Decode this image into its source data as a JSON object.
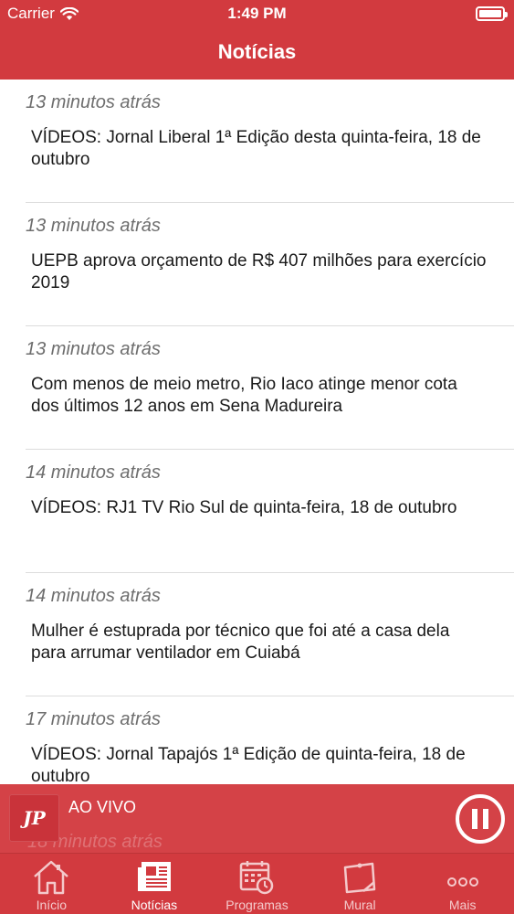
{
  "status_bar": {
    "carrier": "Carrier",
    "time": "1:49 PM"
  },
  "header": {
    "title": "Notícias"
  },
  "news": [
    {
      "time_ago": "13 minutos atrás",
      "title": "VÍDEOS: Jornal Liberal 1ª Edição desta quinta-feira, 18 de outubro"
    },
    {
      "time_ago": "13 minutos atrás",
      "title": "UEPB aprova orçamento de R$ 407 milhões para exercício 2019"
    },
    {
      "time_ago": "13 minutos atrás",
      "title": "Com menos de meio metro, Rio Iaco atinge menor cota dos últimos 12 anos em Sena Madureira"
    },
    {
      "time_ago": "14 minutos atrás",
      "title": "VÍDEOS: RJ1 TV Rio Sul de quinta-feira, 18 de outubro"
    },
    {
      "time_ago": "14 minutos atrás",
      "title": "Mulher é estuprada por técnico que foi até a casa dela para arrumar ventilador em Cuiabá"
    },
    {
      "time_ago": "17 minutos atrás",
      "title": "VÍDEOS: Jornal Tapajós 1ª Edição de quinta-feira, 18 de outubro"
    }
  ],
  "player": {
    "live_label": "AO VIVO",
    "logo_text": "JP",
    "obscured_time": "18 minutos atrás"
  },
  "tabs": [
    {
      "label": "Início",
      "icon": "home-icon",
      "active": false
    },
    {
      "label": "Notícias",
      "icon": "newspaper-icon",
      "active": true
    },
    {
      "label": "Programas",
      "icon": "calendar-icon",
      "active": false
    },
    {
      "label": "Mural",
      "icon": "board-icon",
      "active": false
    },
    {
      "label": "Mais",
      "icon": "more-icon",
      "active": false
    }
  ],
  "colors": {
    "brand": "#d23a3f",
    "text": "#1a1a1a",
    "muted": "#6e6e6e"
  }
}
